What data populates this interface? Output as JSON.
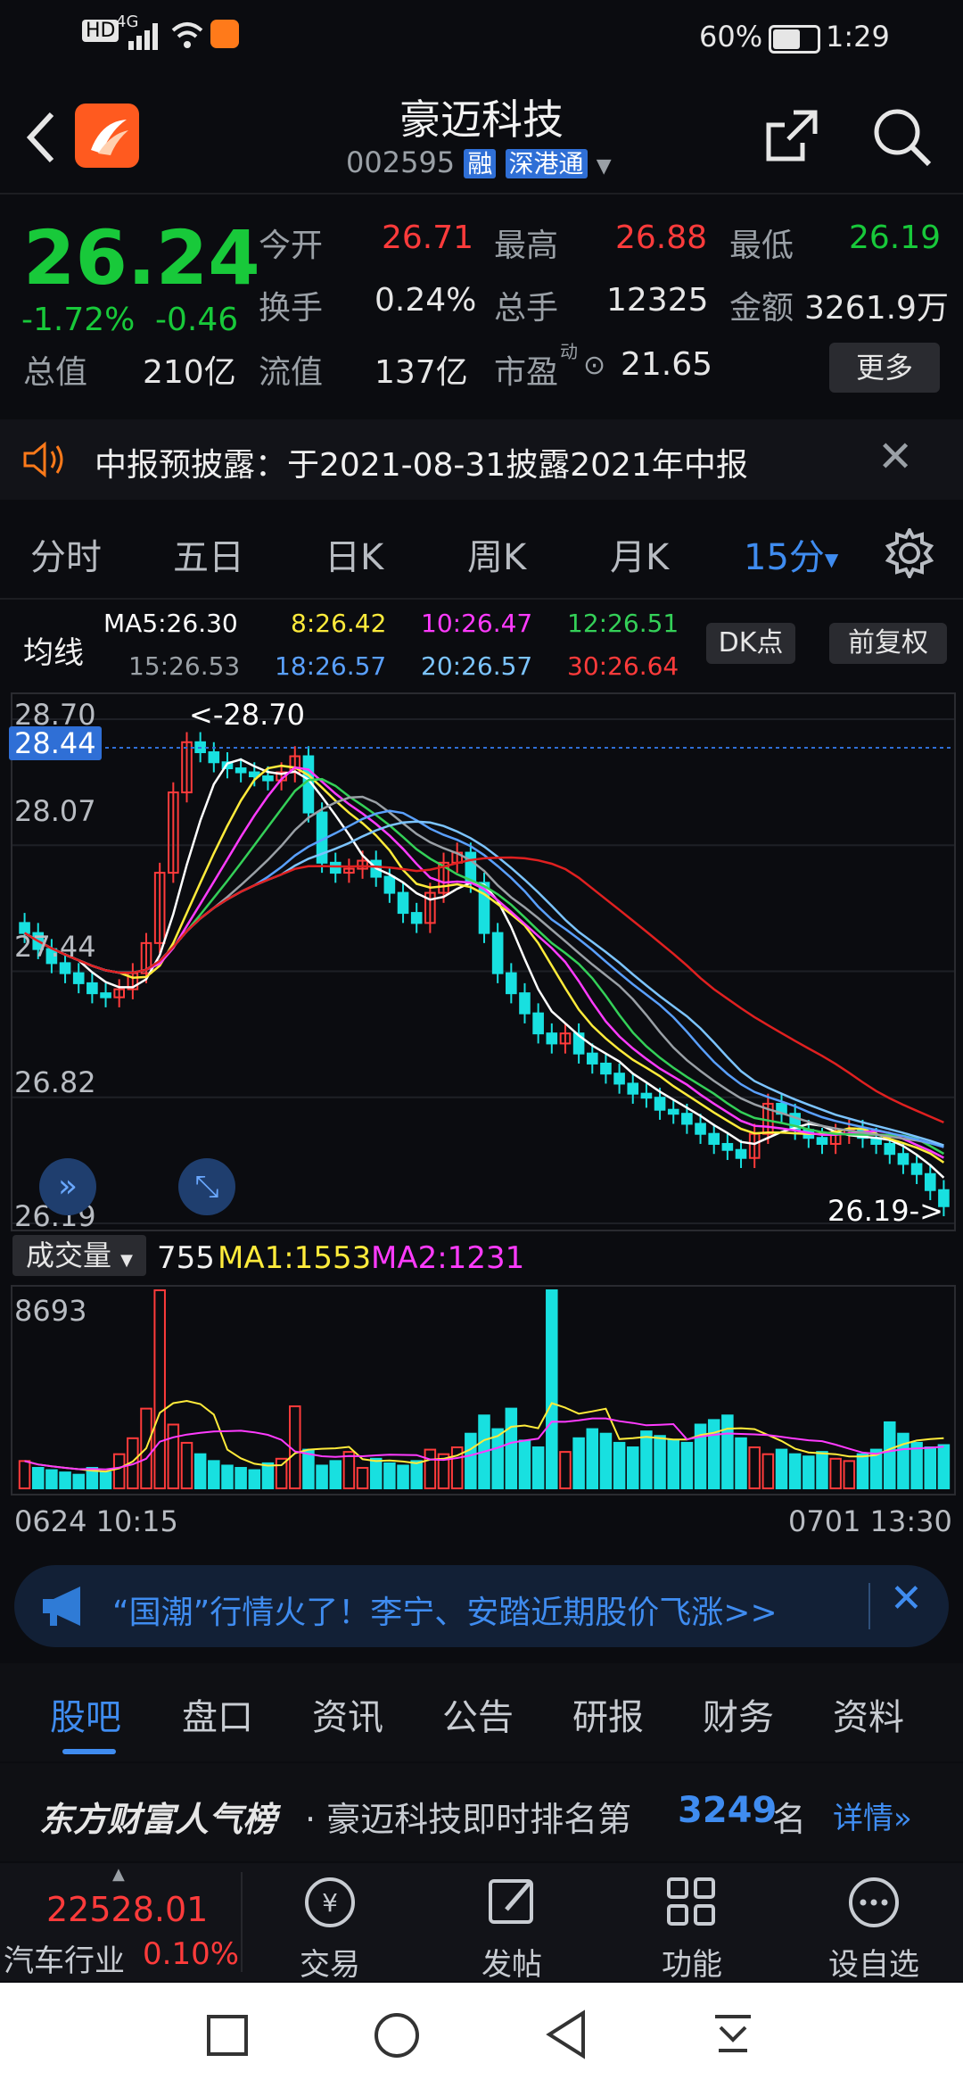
{
  "statusbar": {
    "battery": "60%",
    "time": "1:29",
    "signal_label": "4G"
  },
  "header": {
    "title": "豪迈科技",
    "code": "002595",
    "badge1": "融",
    "badge2": "深港通"
  },
  "quote": {
    "price": "26.24",
    "pct": "-1.72%",
    "change": "-0.46",
    "open_label": "今开",
    "open": "26.71",
    "high_label": "最高",
    "high": "26.88",
    "low_label": "最低",
    "low": "26.19",
    "turnover_label": "换手",
    "turnover": "0.24%",
    "volume_label": "总手",
    "volume": "12325",
    "amount_label": "金额",
    "amount": "3261.9万",
    "mktcap_label": "总值",
    "mktcap": "210亿",
    "float_label": "流值",
    "float": "137亿",
    "pe_label": "市盈",
    "pe_sup": "动",
    "pe": "21.65",
    "more_label": "更多"
  },
  "notice": {
    "text": "中报预披露：于2021-08-31披露2021年中报"
  },
  "periods": {
    "tabs": [
      "分时",
      "五日",
      "日K",
      "周K",
      "月K"
    ],
    "active": "15分"
  },
  "ma_legend": {
    "title": "均线",
    "ma5": "MA5:26.30",
    "ma8": "8:26.42",
    "ma10": "10:26.47",
    "ma12": "12:26.51",
    "ma15": "15:26.53",
    "ma18": "18:26.57",
    "ma20": "20:26.57",
    "ma30": "30:26.64",
    "dk_label": "DK点",
    "fq_label": "前复权"
  },
  "colors": {
    "up": "#ff3b3b",
    "down": "#18e0e0",
    "ma5": "#ffffff",
    "ma8": "#ffeb3b",
    "ma10": "#ff3bff",
    "ma12": "#34d058",
    "ma15": "#9aa0a6",
    "ma18": "#5aa0ff",
    "ma20": "#7cc4ff",
    "ma30": "#e02020"
  },
  "chart_data": {
    "type": "candlestick",
    "y_ticks": [
      "28.70",
      "28.07",
      "27.44",
      "26.82",
      "26.19"
    ],
    "current_price_label": "28.44",
    "high_marker": "<-28.70",
    "low_marker": "26.19->",
    "ylim": [
      26.19,
      28.7
    ],
    "x_start": "0624 10:15",
    "x_end": "0701 13:30",
    "closes": [
      27.6,
      27.52,
      27.45,
      27.4,
      27.35,
      27.3,
      27.28,
      27.32,
      27.4,
      27.55,
      27.9,
      28.3,
      28.55,
      28.5,
      28.45,
      28.42,
      28.4,
      28.38,
      28.36,
      28.4,
      28.48,
      28.2,
      27.95,
      27.9,
      27.92,
      27.96,
      27.88,
      27.8,
      27.7,
      27.65,
      27.8,
      27.95,
      28.0,
      27.85,
      27.6,
      27.4,
      27.3,
      27.2,
      27.1,
      27.05,
      27.1,
      27.0,
      26.95,
      26.9,
      26.85,
      26.8,
      26.78,
      26.72,
      26.7,
      26.65,
      26.6,
      26.55,
      26.52,
      26.48,
      26.6,
      26.75,
      26.7,
      26.62,
      26.58,
      26.55,
      26.6,
      26.62,
      26.58,
      26.55,
      26.5,
      26.45,
      26.4,
      26.32,
      26.24
    ]
  },
  "volume": {
    "label": "成交量",
    "value": "755",
    "ma1": "MA1:1553",
    "ma2": "MA2:1231",
    "max_tick": "8693",
    "bars": [
      1200,
      900,
      800,
      700,
      600,
      900,
      700,
      1500,
      2200,
      3500,
      8693,
      2800,
      2000,
      1500,
      1200,
      1000,
      900,
      800,
      1100,
      1300,
      3600,
      1700,
      1000,
      1200,
      1600,
      900,
      1300,
      1100,
      1000,
      1200,
      1700,
      1500,
      1800,
      2400,
      3200,
      2600,
      3500,
      2100,
      1800,
      8693,
      1600,
      2200,
      2600,
      2400,
      2000,
      1800,
      2500,
      2300,
      2100,
      2000,
      2800,
      3000,
      3200,
      2200,
      1800,
      1500,
      1700,
      1500,
      1400,
      1600,
      1300,
      1200,
      1500,
      1700,
      2900,
      2400,
      2000,
      1800,
      1900
    ]
  },
  "ad": {
    "text": "“国潮”行情火了！李宁、安踏近期股价飞涨>>"
  },
  "news_tabs": {
    "items": [
      "股吧",
      "盘口",
      "资讯",
      "公告",
      "研报",
      "财务",
      "资料"
    ],
    "active": "股吧"
  },
  "rank": {
    "brand": "东方财富人气榜",
    "text_pre": "· 豪迈科技即时排名第",
    "rank": "3249",
    "text_post": "名",
    "detail": "详情"
  },
  "bottombar": {
    "index_value": "22528.01",
    "index_name": "汽车行业",
    "index_pct": "0.10%",
    "trade": "交易",
    "post": "发帖",
    "func": "功能",
    "watch": "设自选"
  }
}
